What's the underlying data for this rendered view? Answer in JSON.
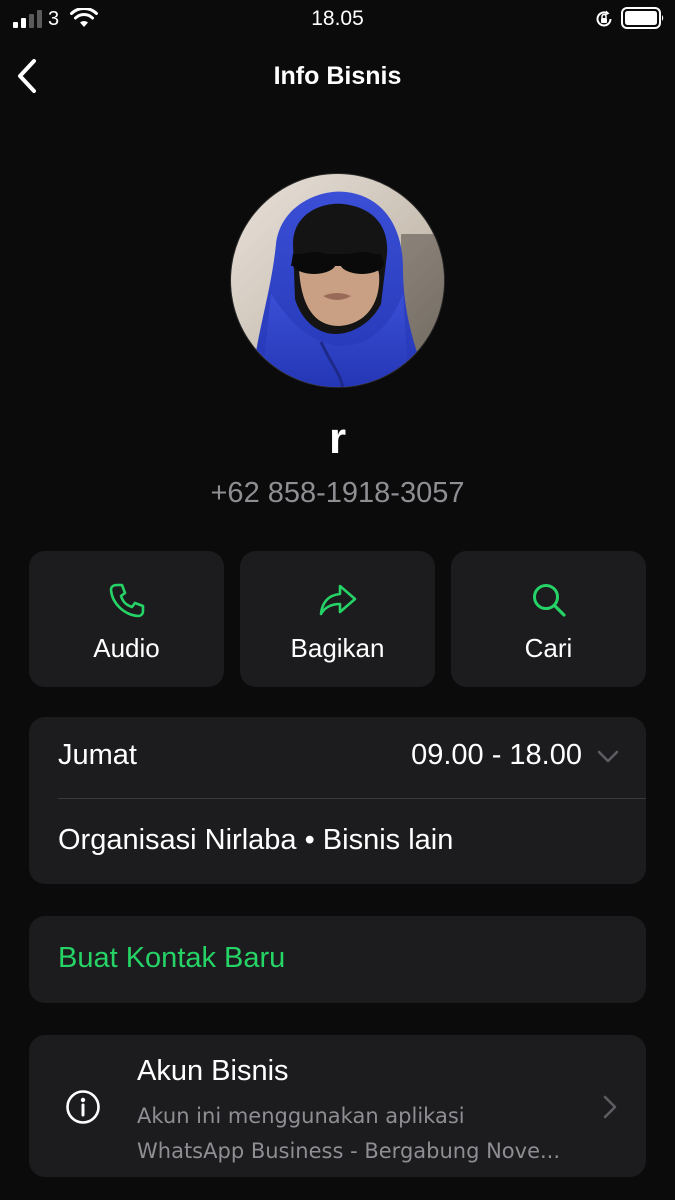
{
  "status_bar": {
    "carrier": "3",
    "time": "18.05",
    "icons": [
      "signal-icon",
      "wifi-icon",
      "rotation-lock-icon",
      "battery-icon"
    ]
  },
  "nav": {
    "title": "Info Bisnis",
    "back_icon": "chevron-left-icon"
  },
  "profile": {
    "name": "r",
    "phone": "+62 858-1918-3057"
  },
  "actions": [
    {
      "label": "Audio",
      "icon": "phone-icon"
    },
    {
      "label": "Bagikan",
      "icon": "share-arrow-icon"
    },
    {
      "label": "Cari",
      "icon": "search-icon"
    }
  ],
  "hours": {
    "day": "Jumat",
    "time": "09.00 - 18.00"
  },
  "category": "Organisasi Nirlaba • Bisnis lain",
  "new_contact": {
    "label": "Buat Kontak Baru"
  },
  "business_account": {
    "title": "Akun Bisnis",
    "description_line1": "Akun ini menggunakan aplikasi",
    "description_line2": "WhatsApp Business - Bergabung Nove..."
  },
  "colors": {
    "background": "#0b0b0b",
    "card": "#1c1c1e",
    "accent_green": "#25d366",
    "secondary_text": "#8e8e93"
  }
}
